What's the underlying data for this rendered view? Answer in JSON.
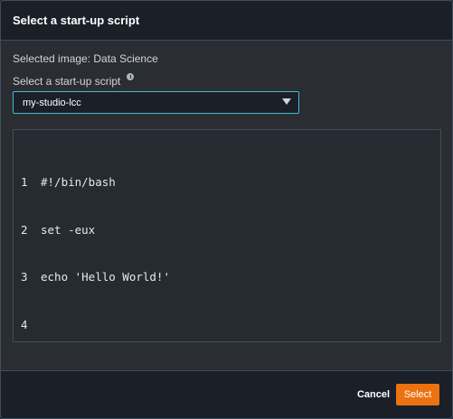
{
  "dialog": {
    "title": "Select a start-up script"
  },
  "body": {
    "selected_image_text": "Selected image: Data Science",
    "script_select_label": "Select a start-up script",
    "script_select_value": "my-studio-lcc",
    "info_icon": "info-icon",
    "dropdown_icon": "caret-down-icon"
  },
  "script": {
    "lines": [
      {
        "no": "1",
        "text": "#!/bin/bash"
      },
      {
        "no": "2",
        "text": "set -eux"
      },
      {
        "no": "3",
        "text": "echo 'Hello World!'"
      },
      {
        "no": "4",
        "text": ""
      }
    ]
  },
  "footer": {
    "cancel_label": "Cancel",
    "select_label": "Select"
  },
  "colors": {
    "accent": "#ec7211",
    "focus_border": "#44b9d6",
    "header_bg": "#1b2028",
    "body_bg": "#2a2e33"
  }
}
